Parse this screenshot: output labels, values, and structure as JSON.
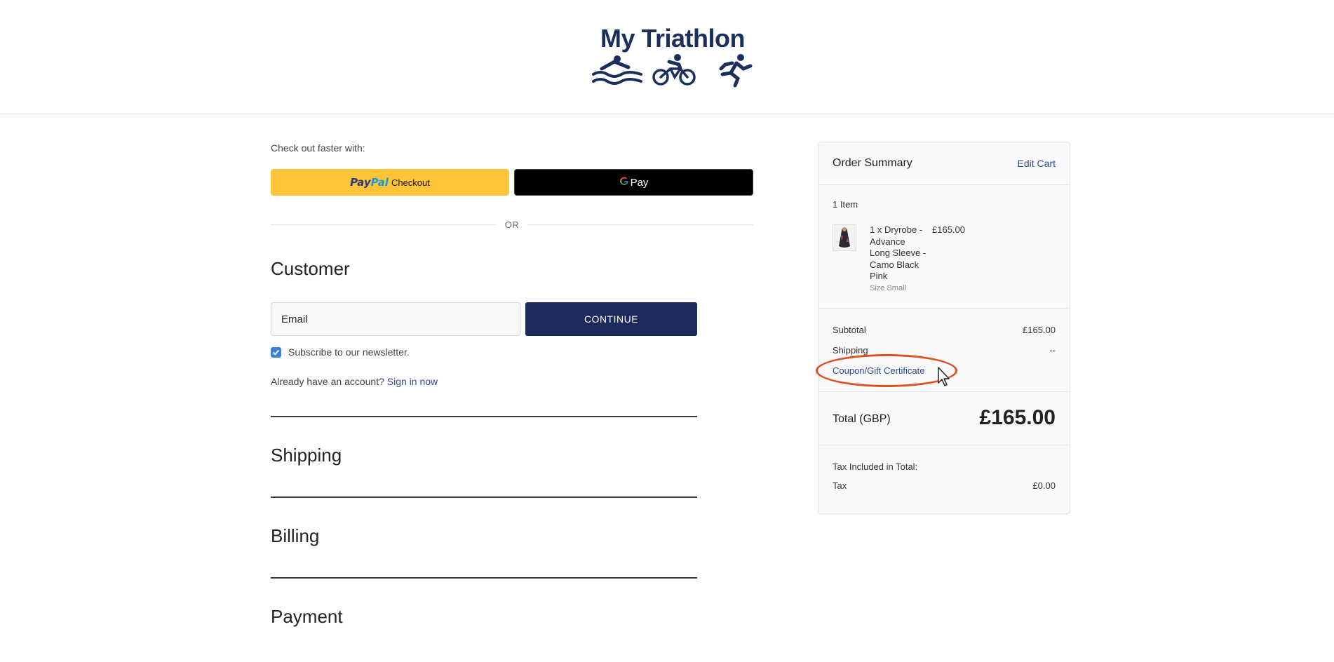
{
  "header": {
    "logo_text": "My Triathlon",
    "logo_icons": [
      "swim-icon",
      "bike-icon",
      "run-icon"
    ],
    "brand_color": "#1b2f5e"
  },
  "checkout": {
    "faster_label": "Check out faster with:",
    "paypal": {
      "pay": "Pay",
      "pal": "Pal",
      "checkout": "Checkout"
    },
    "gpay": {
      "g": "G",
      "label": "Pay"
    },
    "or_label": "OR",
    "customer": {
      "title": "Customer",
      "email_placeholder": "Email",
      "continue_label": "CONTINUE",
      "subscribe_label": "Subscribe to our newsletter.",
      "subscribe_checked": true,
      "account_prompt": "Already have an account?",
      "sign_in_label": "Sign in now"
    },
    "sections": {
      "shipping": "Shipping",
      "billing": "Billing",
      "payment": "Payment"
    },
    "accent_color": "#1d2b5c"
  },
  "summary": {
    "title": "Order Summary",
    "edit_cart": "Edit Cart",
    "item_count": "1 Item",
    "item": {
      "name": "1 x Dryrobe - Advance Long Sleeve - Camo Black Pink",
      "size": "Size Small",
      "price": "£165.00"
    },
    "subtotal_label": "Subtotal",
    "subtotal_value": "£165.00",
    "shipping_label": "Shipping",
    "shipping_value": "--",
    "coupon_label": "Coupon/Gift Certificate",
    "total_label": "Total (GBP)",
    "total_value": "£165.00",
    "tax_included_label": "Tax Included in Total:",
    "tax_label": "Tax",
    "tax_value": "£0.00"
  },
  "annotation_color": "#e0501e"
}
